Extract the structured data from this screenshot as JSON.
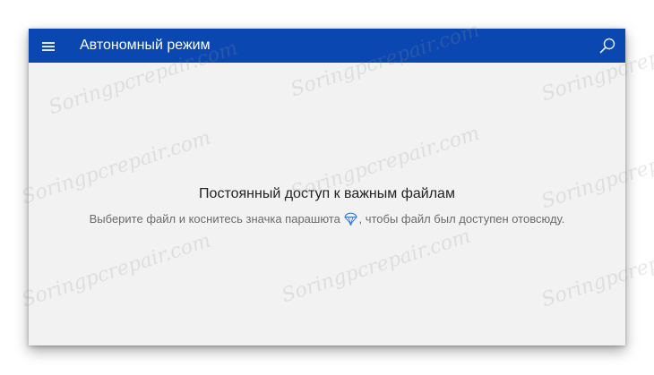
{
  "app_bar": {
    "title": "Автономный режим",
    "menu_icon": "hamburger-menu-icon",
    "search_icon": "search-icon",
    "color": "#0a47b1"
  },
  "empty_state": {
    "title": "Постоянный доступ к важным файлам",
    "description_before_icon": "Выберите файл и коснитесь значка парашюта ",
    "icon": "parachute-icon",
    "description_after_icon": ", чтобы файл был доступен отовсюду."
  },
  "watermark": {
    "text": "Soringpcrepair.com"
  }
}
